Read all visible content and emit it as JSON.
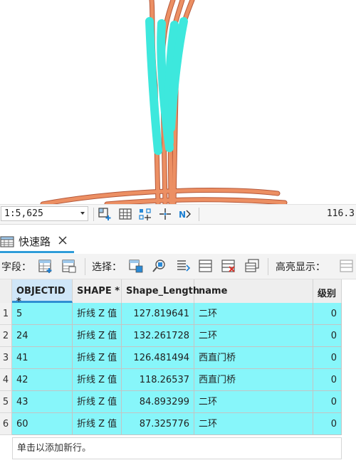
{
  "map": {
    "colors": {
      "road": "#e8885c",
      "road_outline": "#b5583a",
      "selected": "#3de8dd"
    }
  },
  "statusbar": {
    "scale": "1:5,625",
    "coordinate": "116.3",
    "icons": [
      "add-layout-icon",
      "grid-icon",
      "snapping-icon",
      "crosshair-icon",
      "north-arrow-icon"
    ]
  },
  "table_tab": {
    "label": "快速路",
    "icon": "table-icon",
    "close_icon": "close-icon"
  },
  "toolbar": {
    "fields_label": "字段：",
    "select_label": "选择：",
    "highlight_label": "高亮显示："
  },
  "table": {
    "columns": [
      "OBJECTID *",
      "SHAPE *",
      "Shape_Length",
      "name",
      "级别"
    ],
    "rows": [
      {
        "num": "1",
        "objectid": "5",
        "shape": "折线 Z 值",
        "length": "127.819641",
        "name": "二环",
        "level": "0"
      },
      {
        "num": "2",
        "objectid": "24",
        "shape": "折线 Z 值",
        "length": "132.261728",
        "name": "二环",
        "level": "0"
      },
      {
        "num": "3",
        "objectid": "41",
        "shape": "折线 Z 值",
        "length": "126.481494",
        "name": "西直门桥",
        "level": "0"
      },
      {
        "num": "4",
        "objectid": "42",
        "shape": "折线 Z 值",
        "length": "118.26537",
        "name": "西直门桥",
        "level": "0"
      },
      {
        "num": "5",
        "objectid": "43",
        "shape": "折线 Z 值",
        "length": "84.893299",
        "name": "二环",
        "level": "0"
      },
      {
        "num": "6",
        "objectid": "60",
        "shape": "折线 Z 值",
        "length": "87.325776",
        "name": "二环",
        "level": "0"
      }
    ],
    "add_row_hint": "单击以添加新行。",
    "selected_color": "#87f6fa"
  }
}
